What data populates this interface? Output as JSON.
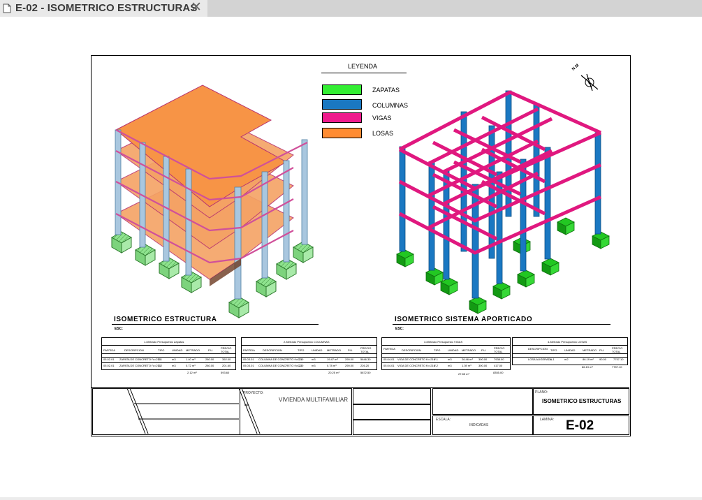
{
  "tab": {
    "title": "E-02 - ISOMETRICO ESTRUCTURAS",
    "close": "✕"
  },
  "colors": {
    "zapatas": "#33ee33",
    "columnas": "#1a78c2",
    "vigas": "#ee1a8c",
    "losas": "#ff8c33"
  },
  "legend": {
    "title": "LEYENDA",
    "items": [
      {
        "label": "ZAPATAS",
        "color": "#33ee33"
      },
      {
        "label": "COLUMNAS",
        "color": "#1a78c2"
      },
      {
        "label": "VIGAS",
        "color": "#ee1a8c"
      },
      {
        "label": "LOSAS",
        "color": "#ff8c33"
      }
    ]
  },
  "compass": {
    "label": "N M"
  },
  "views": {
    "left": {
      "title": "ISOMETRICO ESTRUCTURA",
      "scale": "ESC:"
    },
    "right": {
      "title": "ISOMETRICO  SISTEMA APORTICADO",
      "scale": "ESC:"
    }
  },
  "schedules": [
    {
      "title": "1-Metrado Presupuesto Zapatas",
      "headers": [
        "PARTIDA",
        "DESCRIPCION",
        "TIPO",
        "UNIDAD",
        "METRADO",
        "P.U.",
        "PRECIO TOTAL"
      ],
      "rows": [
        [
          "05.02.01",
          "ZAPATA DE CONCRETO f'c=210",
          "Z-1",
          "m3",
          "1.40 m³",
          "280.00",
          "392.00"
        ],
        [
          "05.02.01",
          "ZAPATA DE CONCRETO f'c=210",
          "Z-2",
          "m3",
          "0.72 m³",
          "280.00",
          "201.60"
        ]
      ],
      "totals": [
        "2.12 m³",
        "593.60"
      ]
    },
    {
      "title": "2-Metrado Presupuesto COLUMNAS",
      "headers": [
        "PARTIDA",
        "DESCRIPCION",
        "TIPO",
        "UNIDAD",
        "METRADO",
        "P.U.",
        "PRECIO TOTAL"
      ],
      "rows": [
        [
          "05.03.01",
          "COLUMNA DE CONCRETO f'c=210",
          "C-1",
          "m3",
          "19.47 m³",
          "290.00",
          "5646.30"
        ],
        [
          "05.03.01",
          "COLUMNA DE CONCRETO f'c=210",
          "C-2",
          "m3",
          "0.78 m³",
          "290.00",
          "226.20"
        ]
      ],
      "totals": [
        "20.25 m³",
        "5872.50"
      ]
    },
    {
      "title": "3-Metrado Presupuesto VIGAS",
      "headers": [
        "PARTIDA",
        "DESCRIPCION",
        "TIPO",
        "UNIDAD",
        "METRADO",
        "P.U.",
        "PRECIO TOTAL"
      ],
      "rows": [
        [
          "05.04.01",
          "VIGA DE CONCRETO f'c=210",
          "V-1",
          "m3",
          "26.46 m³",
          "300.00",
          "7938.00"
        ],
        [
          "05.04.01",
          "VIGA DE CONCRETO f'c=210",
          "V-2",
          "m3",
          "1.39 m³",
          "300.00",
          "417.00"
        ]
      ],
      "totals": [
        "27.85 m³",
        "8355.00"
      ]
    },
    {
      "title": "4-Metrado Presupuesto LOSAS",
      "headers": [
        "DESCRIPCION",
        "TIPO",
        "UNIDAD",
        "METRADO",
        "P.U.",
        "PRECIO TOTAL"
      ],
      "rows": [
        [
          "LOSA ALIGERADA",
          "L-1",
          "m2",
          "86.19 m²",
          "90.00",
          "7757.10"
        ]
      ],
      "totals": [
        "86.19 m²",
        "7757.10"
      ]
    }
  ],
  "titleblock": {
    "project_label": "PROYECTO:",
    "project_name": "VIVIENDA MULTIFAMILIAR",
    "scale_label": "ESCALA:",
    "scale_value": "INDICADAS",
    "plan_label": "PLANO:",
    "plan_name": "ISOMETRICO ESTRUCTURAS",
    "sheet_label": "LAMINA:",
    "sheet_code": "E-02"
  }
}
